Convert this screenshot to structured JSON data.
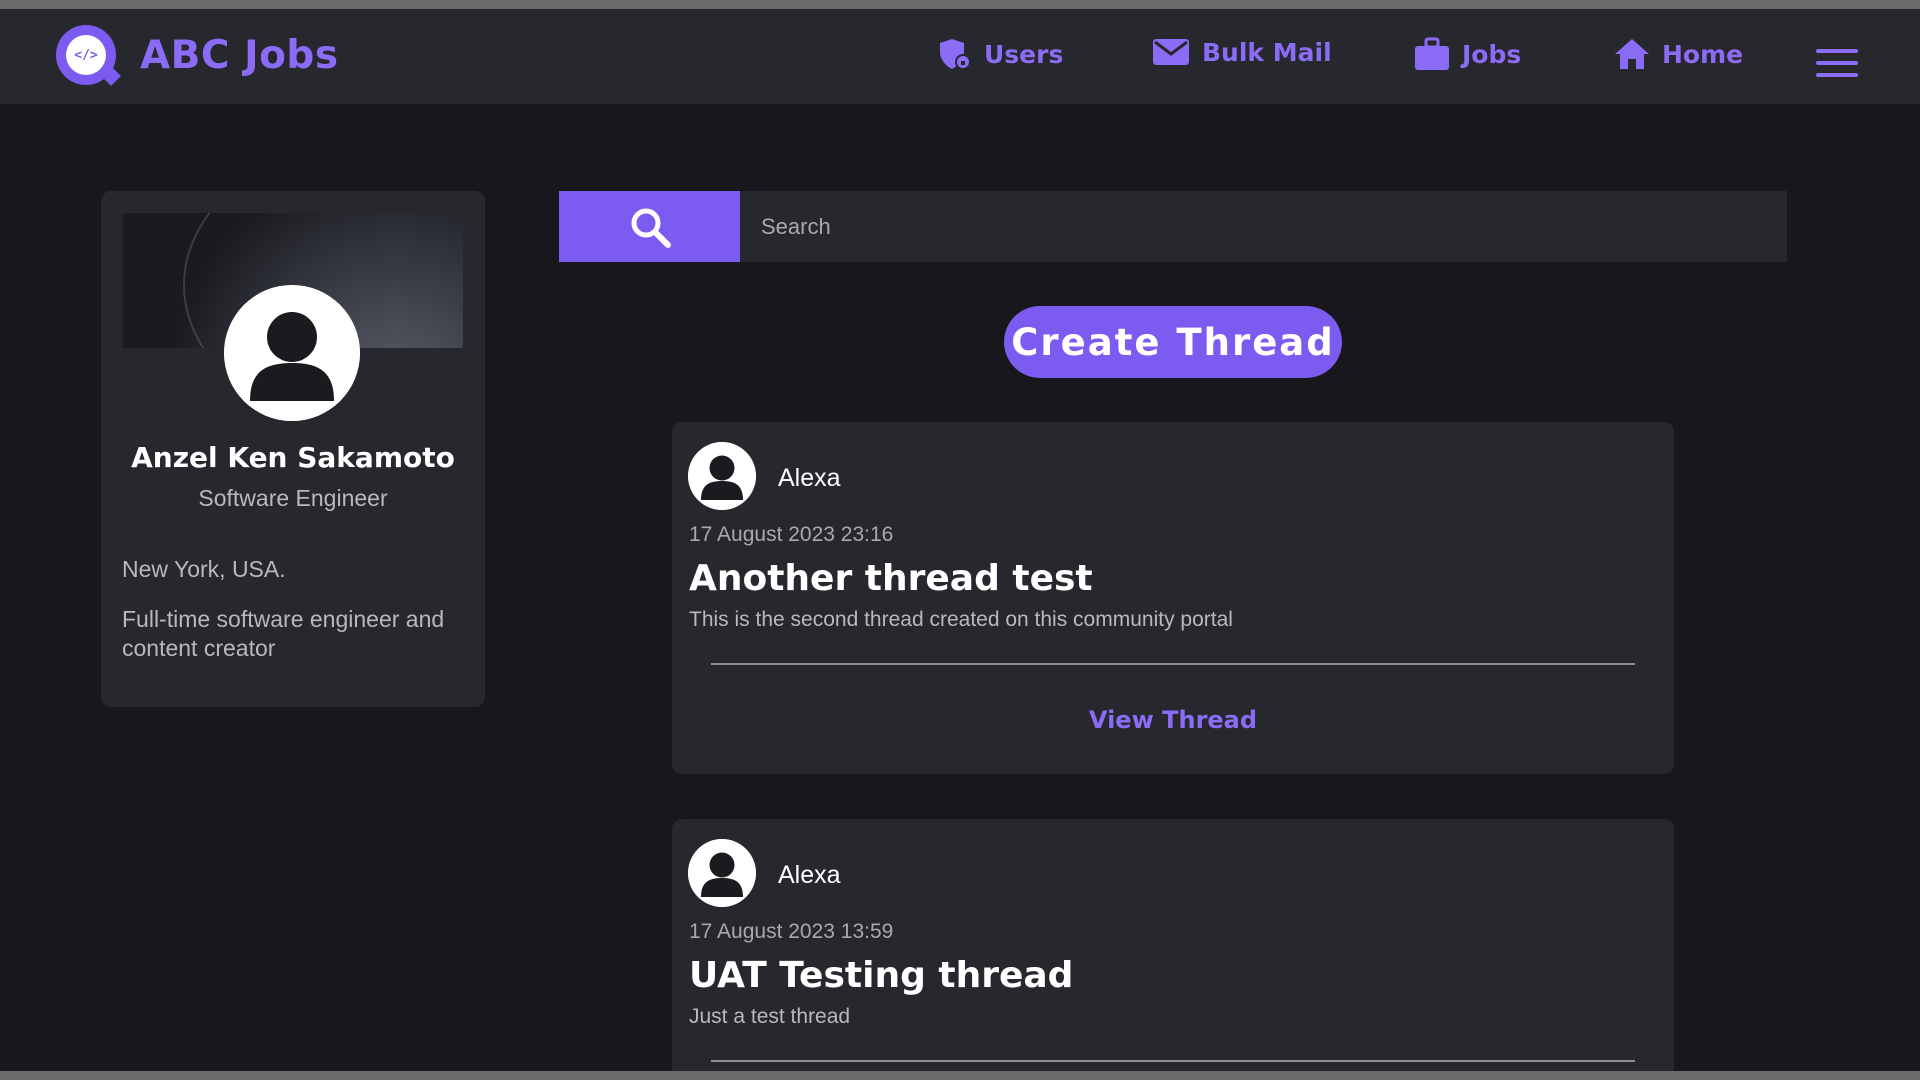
{
  "brand": {
    "title": "ABC Jobs",
    "logo_text": "</>"
  },
  "nav": {
    "users": "Users",
    "bulk_mail": "Bulk Mail",
    "jobs": "Jobs",
    "home": "Home"
  },
  "colors": {
    "accent": "#7c5cf0",
    "accent_text": "#8b6cf6",
    "background": "#17171c",
    "panel": "#27282d"
  },
  "icons": {
    "users": "user-shield-icon",
    "bulk_mail": "envelope-icon",
    "jobs": "briefcase-icon",
    "home": "home-icon",
    "menu": "hamburger-icon",
    "search": "search-icon"
  },
  "profile": {
    "name": "Anzel Ken Sakamoto",
    "role": "Software Engineer",
    "location": "New York, USA.",
    "bio": "Full-time software engineer and content creator"
  },
  "search": {
    "placeholder": "Search"
  },
  "create_thread": {
    "label": "Create Thread"
  },
  "threads": [
    {
      "author": "Alexa",
      "date": "17 August 2023 23:16",
      "title": "Another thread test",
      "description": "This is the second thread created on this community portal",
      "view_label": "View Thread"
    },
    {
      "author": "Alexa",
      "date": "17 August 2023 13:59",
      "title": "UAT Testing thread",
      "description": "Just a test thread"
    }
  ]
}
